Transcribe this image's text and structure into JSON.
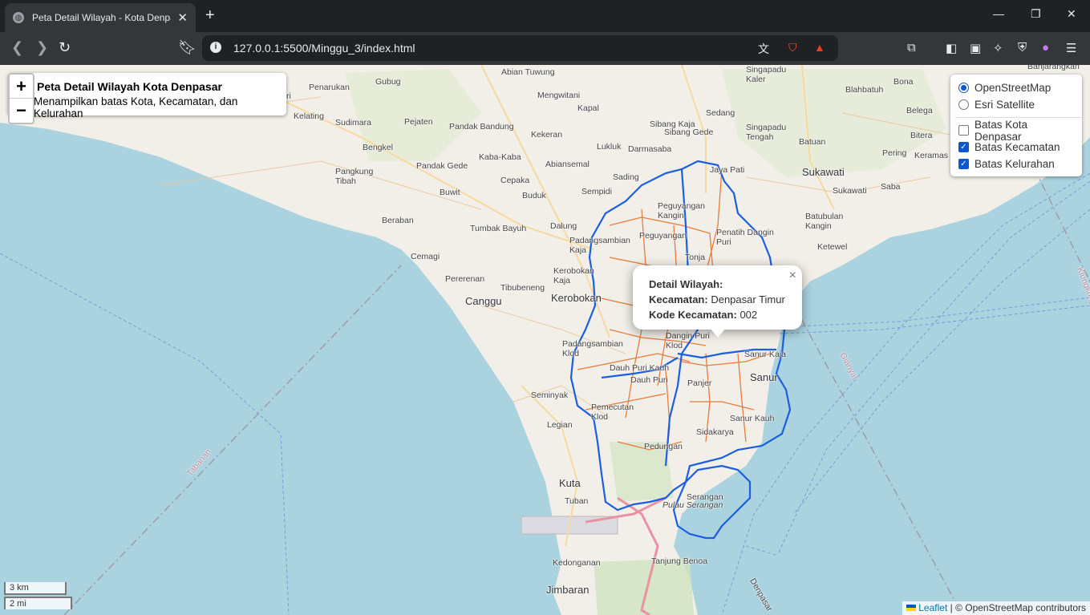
{
  "browser": {
    "tab_title": "Peta Detail Wilayah - Kota Denpasar",
    "url": "127.0.0.1:5500/Minggu_3/index.html"
  },
  "map": {
    "title": "Peta Detail Wilayah Kota Denpasar",
    "subtitle": "Menampilkan batas Kota, Kecamatan, dan Kelurahan",
    "zoom_in": "+",
    "zoom_out": "−",
    "layer_control": {
      "base_layers": [
        {
          "label": "OpenStreetMap",
          "selected": true
        },
        {
          "label": "Esri Satellite",
          "selected": false
        }
      ],
      "overlays": [
        {
          "label": "Batas Kota Denpasar",
          "checked": false
        },
        {
          "label": "Batas Kecamatan",
          "checked": true
        },
        {
          "label": "Batas Kelurahan",
          "checked": true
        }
      ]
    },
    "popup": {
      "heading": "Detail Wilayah:",
      "kecamatan_label": "Kecamatan:",
      "kecamatan_value": "Denpasar Timur",
      "kode_label": "Kode Kecamatan:",
      "kode_value": "002",
      "close": "×"
    },
    "scale": {
      "metric": "3 km",
      "imperial": "2 mi"
    },
    "attribution": {
      "leaflet": "Leaflet",
      "rest": "| © OpenStreetMap contributors"
    },
    "place_labels": [
      "Abian Tuwung",
      "Mengwitani",
      "Kapal",
      "Penarukan",
      "Sudimara",
      "Pejaten",
      "Kelating",
      "Pandak Bandung",
      "Kekeran",
      "Bengkel",
      "Pandak Gede",
      "Kaba-Kaba",
      "Lukluk",
      "Darmasaba",
      "Abiansemal",
      "Sibang Kaja",
      "Sibang Gede",
      "Sedang",
      "Singapadu Kaler",
      "Singapadu Tengah",
      "Batuan",
      "Blahbatuh",
      "Bona",
      "Belega",
      "Bitera",
      "Keramas",
      "Pering",
      "Sukawati",
      "Saba",
      "Batubulan Kangin",
      "Ketewel",
      "Jaya Pati",
      "Pangkung Tibah",
      "Buwit",
      "Cepaka",
      "Buduk",
      "Sempidi",
      "Sading",
      "Beraban",
      "Tumbak Bayuh",
      "Dalung",
      "Cemagi",
      "Pererenan",
      "Tibubeneng",
      "Canggu",
      "Kerobokan",
      "Kerobokan Kaja",
      "Padangsambian Kaja",
      "Padangsambian Klod",
      "Peguyangan Kangin",
      "Peguyangan",
      "Penatih Dangin Puri",
      "Tonja",
      "Dangin Puri Klod",
      "Dauh Puri Kauh",
      "Dauh Puri",
      "Panjer",
      "Sanur",
      "Sanur Kaja",
      "Sanur Kauh",
      "Sidakarya",
      "Pemecutan Klod",
      "Pedungan",
      "Seminyak",
      "Legian",
      "Kuta",
      "Tuban",
      "Serangan",
      "Pulau Serangan",
      "Kedonganan",
      "Tanjung Benoa",
      "Jimbaran",
      "Tabanan",
      "Gianyar",
      "Klungkung",
      "Banjarangkan",
      "Gubug",
      "Kediri",
      "Denpasar"
    ]
  }
}
